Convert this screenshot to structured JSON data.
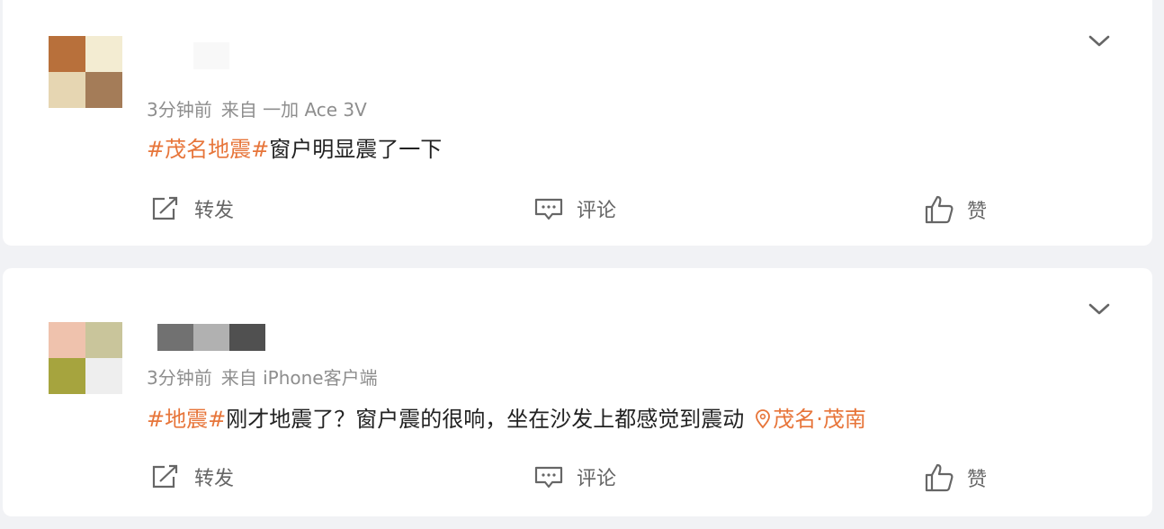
{
  "colors": {
    "tag": "#e7753a",
    "meta": "#8e8e8e",
    "text": "#222222"
  },
  "posts": [
    {
      "avatar_colors": [
        "#b8703b",
        "#f3ecd2",
        "#e6d6b2",
        "#a47c58"
      ],
      "name_blur_colors": [
        "#ffffff",
        "#fafafa"
      ],
      "time": "3分钟前",
      "source": "来自 一加 Ace 3V",
      "tags": [
        "#茂名地震#"
      ],
      "text": "窗户明显震了一下",
      "location": "",
      "actions": {
        "repost": "转发",
        "comment": "评论",
        "like": "赞"
      }
    },
    {
      "avatar_colors": [
        "#efc2ad",
        "#c9c59b",
        "#a6a43e",
        "#eeeeee"
      ],
      "name_blur_colors": [
        "#717171",
        "#b1b1b1",
        "#505050"
      ],
      "time": "3分钟前",
      "source": "来自 iPhone客户端",
      "tags": [
        "#地震#"
      ],
      "text": "刚才地震了？窗户震的很响，坐在沙发上都感觉到震动",
      "location": "茂名·茂南",
      "actions": {
        "repost": "转发",
        "comment": "评论",
        "like": "赞"
      }
    }
  ]
}
